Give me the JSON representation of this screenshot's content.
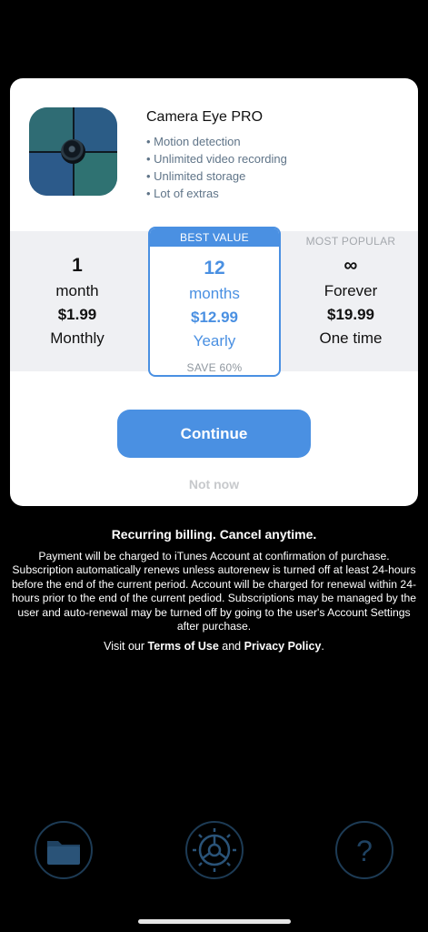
{
  "app": {
    "title": "Camera Eye PRO",
    "features": [
      "Motion detection",
      "Unlimited video recording",
      "Unlimited storage",
      "Lot of extras"
    ]
  },
  "plans": {
    "monthly": {
      "number": "1",
      "unit": "month",
      "price": "$1.99",
      "period": "Monthly"
    },
    "yearly": {
      "badge": "BEST VALUE",
      "number": "12",
      "unit": "months",
      "price": "$12.99",
      "period": "Yearly",
      "save": "SAVE 60%"
    },
    "forever": {
      "badge": "MOST POPULAR",
      "number": "∞",
      "unit": "Forever",
      "price": "$19.99",
      "period": "One time"
    }
  },
  "actions": {
    "continue_label": "Continue",
    "not_now_label": "Not now"
  },
  "billing": {
    "heading": "Recurring billing. Cancel anytime.",
    "text": "Payment will be charged to iTunes Account at confirmation of purchase. Subscription automatically renews unless autorenew is turned off at least 24-hours before the end of the current period. Account will be charged for renewal within 24-hours prior to the end of the current pediod. Subscriptions may be managed by the user and auto-renewal may be turned off by going to the user's Account Settings after purchase.",
    "legal_prefix": "Visit our",
    "terms_label": "Terms of Use",
    "legal_and": "and",
    "privacy_label": "Privacy Policy",
    "legal_suffix": "."
  },
  "bottom_nav": {
    "icons": [
      "folder-icon",
      "settings-icon",
      "help-icon"
    ],
    "help_glyph": "?"
  },
  "colors": {
    "accent": "#4a90e2",
    "background": "#000000",
    "card": "#ffffff",
    "plan_band": "#eff0f3",
    "icon_dark": "#1d3b55"
  }
}
